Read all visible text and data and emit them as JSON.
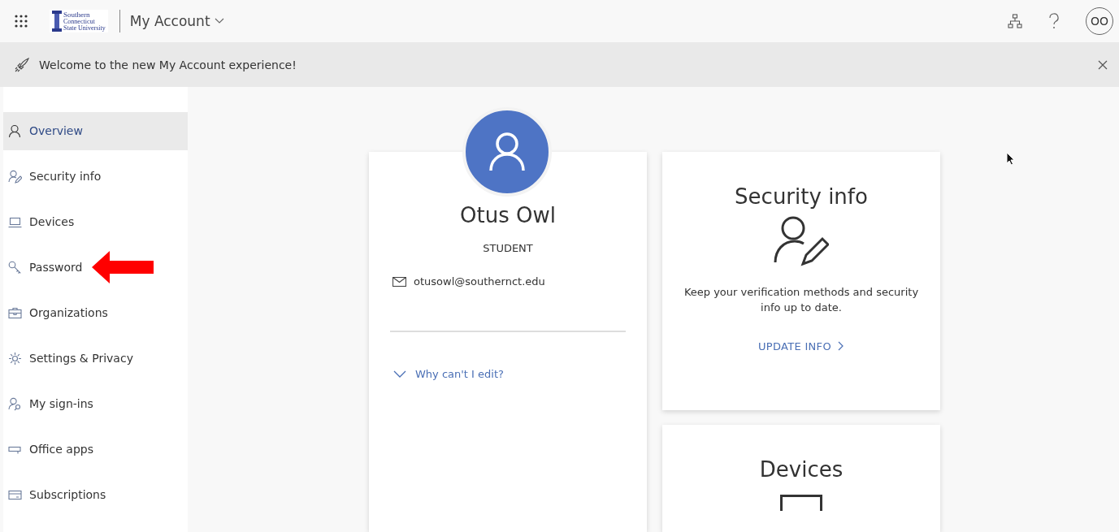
{
  "header": {
    "logo_lines": [
      "Southern",
      "Connecticut",
      "State University"
    ],
    "app_title": "My Account",
    "avatar_initials": "OO"
  },
  "banner": {
    "text": "Welcome to the new My Account experience!"
  },
  "sidebar": {
    "items": [
      {
        "label": "Overview",
        "selected": true
      },
      {
        "label": "Security info",
        "selected": false
      },
      {
        "label": "Devices",
        "selected": false
      },
      {
        "label": "Password",
        "selected": false,
        "annotated": true
      },
      {
        "label": "Organizations",
        "selected": false
      },
      {
        "label": "Settings & Privacy",
        "selected": false
      },
      {
        "label": "My sign-ins",
        "selected": false
      },
      {
        "label": "Office apps",
        "selected": false
      },
      {
        "label": "Subscriptions",
        "selected": false
      }
    ]
  },
  "profile_card": {
    "name": "Otus Owl",
    "role": "STUDENT",
    "email": "otusowl@southernct.edu",
    "expander": "Why can't I edit?"
  },
  "security_card": {
    "title": "Security info",
    "description": "Keep your verification methods and security info up to date.",
    "link": "UPDATE INFO"
  },
  "devices_card": {
    "title": "Devices"
  }
}
